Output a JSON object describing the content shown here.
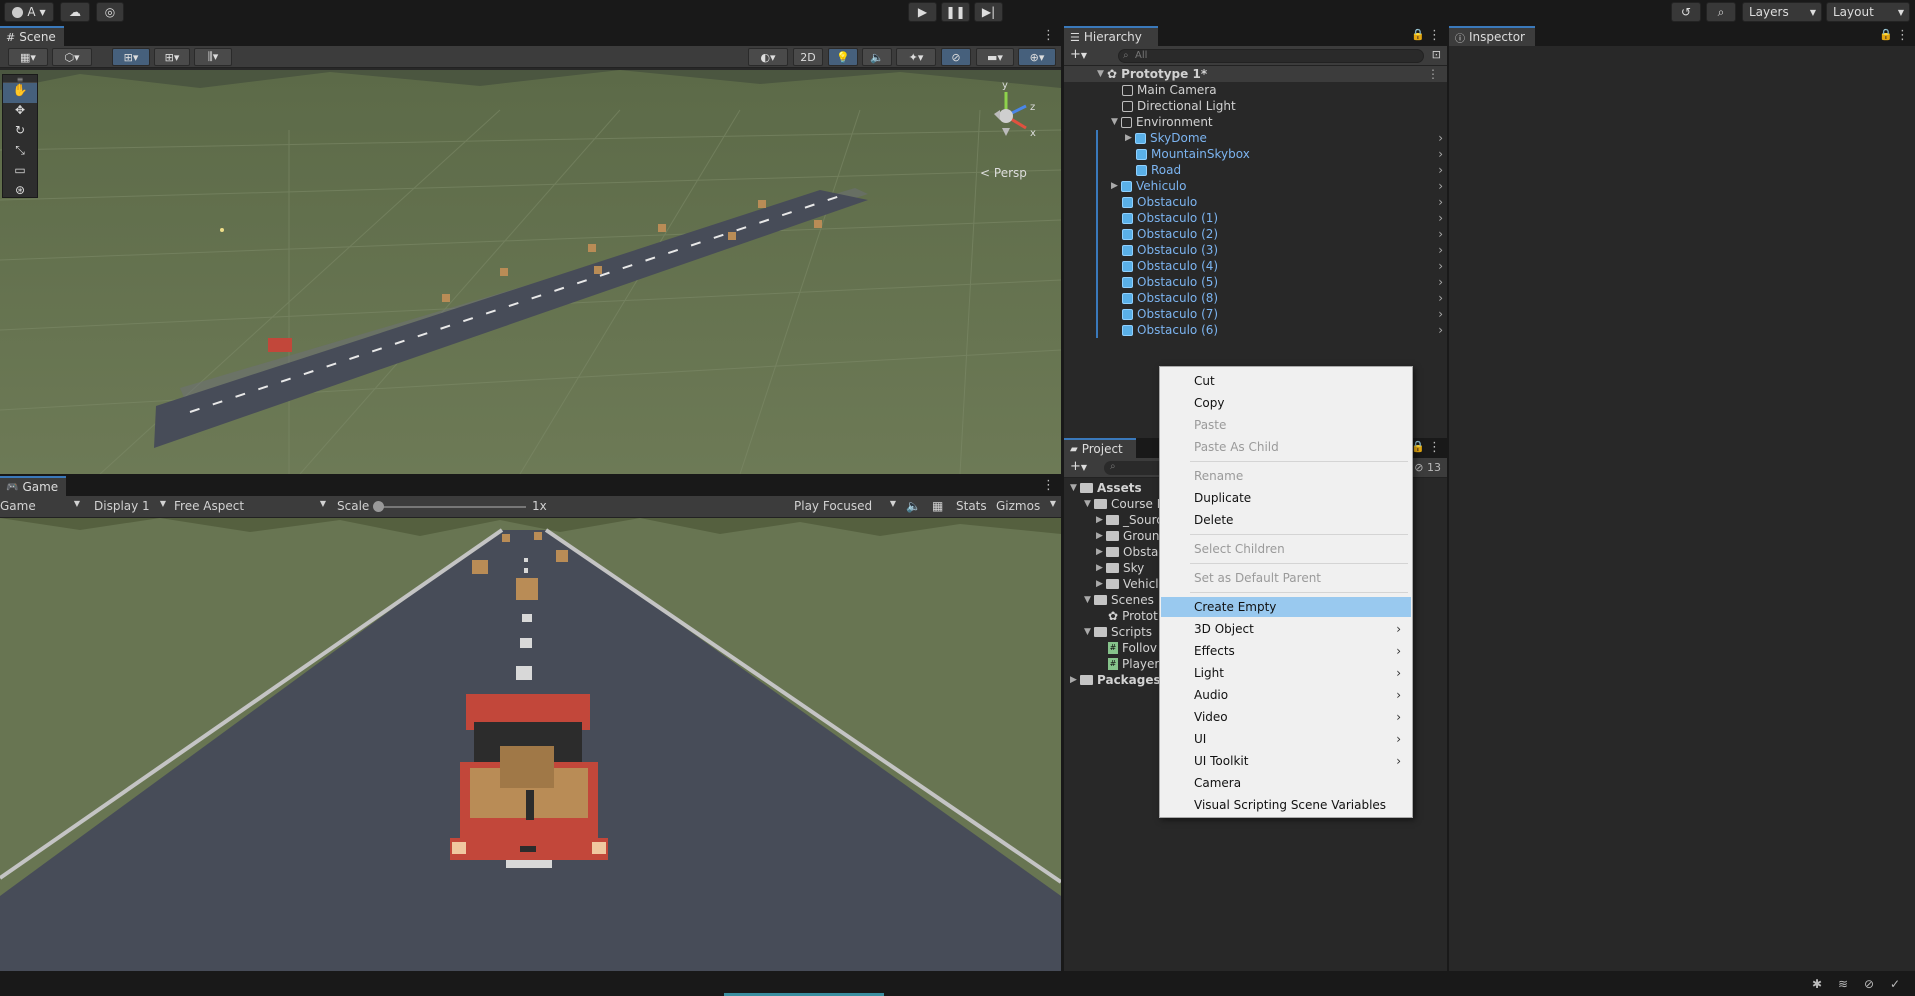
{
  "toolbar": {
    "account_label": "A",
    "layers_label": "Layers",
    "layout_label": "Layout"
  },
  "scene": {
    "tab_label": "Scene",
    "btn_2d": "2D",
    "persp_label": "Persp",
    "gizmo_axes": {
      "x": "x",
      "y": "y",
      "z": "z"
    }
  },
  "game": {
    "tab_label": "Game",
    "mode": "Game",
    "display": "Display 1",
    "aspect": "Free Aspect",
    "scale_label": "Scale",
    "scale_value": "1x",
    "scale_fraction": 0.0,
    "play_mode": "Play Focused",
    "stats": "Stats",
    "gizmos": "Gizmos"
  },
  "hierarchy": {
    "tab_label": "Hierarchy",
    "search_placeholder": "All",
    "scene_root": "Prototype 1*",
    "items": [
      {
        "label": "Main Camera"
      },
      {
        "label": "Directional Light"
      },
      {
        "label": "Environment"
      },
      {
        "label": "SkyDome"
      },
      {
        "label": "MountainSkybox"
      },
      {
        "label": "Road"
      },
      {
        "label": "Vehiculo"
      },
      {
        "label": "Obstaculo"
      },
      {
        "label": "Obstaculo (1)"
      },
      {
        "label": "Obstaculo (2)"
      },
      {
        "label": "Obstaculo (3)"
      },
      {
        "label": "Obstaculo (4)"
      },
      {
        "label": "Obstaculo (5)"
      },
      {
        "label": "Obstaculo (8)"
      },
      {
        "label": "Obstaculo (7)"
      },
      {
        "label": "Obstaculo (6)"
      }
    ]
  },
  "inspector": {
    "tab_label": "Inspector"
  },
  "project": {
    "tab_label": "Project",
    "count": "13",
    "items": [
      {
        "label": "Assets"
      },
      {
        "label": "Course L"
      },
      {
        "label": "_Sourc"
      },
      {
        "label": "Groun"
      },
      {
        "label": "Obsta"
      },
      {
        "label": "Sky"
      },
      {
        "label": "Vehicl"
      },
      {
        "label": "Scenes"
      },
      {
        "label": "Protot"
      },
      {
        "label": "Scripts"
      },
      {
        "label": "Follov"
      },
      {
        "label": "Player"
      },
      {
        "label": "Packages"
      }
    ]
  },
  "context_menu": {
    "items": [
      {
        "label": "Cut"
      },
      {
        "label": "Copy"
      },
      {
        "label": "Paste"
      },
      {
        "label": "Paste As Child"
      },
      {
        "label": "Rename"
      },
      {
        "label": "Duplicate"
      },
      {
        "label": "Delete"
      },
      {
        "label": "Select Children"
      },
      {
        "label": "Set as Default Parent"
      },
      {
        "label": "Create Empty"
      },
      {
        "label": "3D Object"
      },
      {
        "label": "Effects"
      },
      {
        "label": "Light"
      },
      {
        "label": "Audio"
      },
      {
        "label": "Video"
      },
      {
        "label": "UI"
      },
      {
        "label": "UI Toolkit"
      },
      {
        "label": "Camera"
      },
      {
        "label": "Visual Scripting Scene Variables"
      }
    ]
  },
  "colors": {
    "accent": "#3a79bb",
    "prefab_blue": "#7cb4f0",
    "menu_highlight": "#99c9ef",
    "ground": "#687552",
    "road": "#474c58",
    "truck": "#c2473a"
  }
}
